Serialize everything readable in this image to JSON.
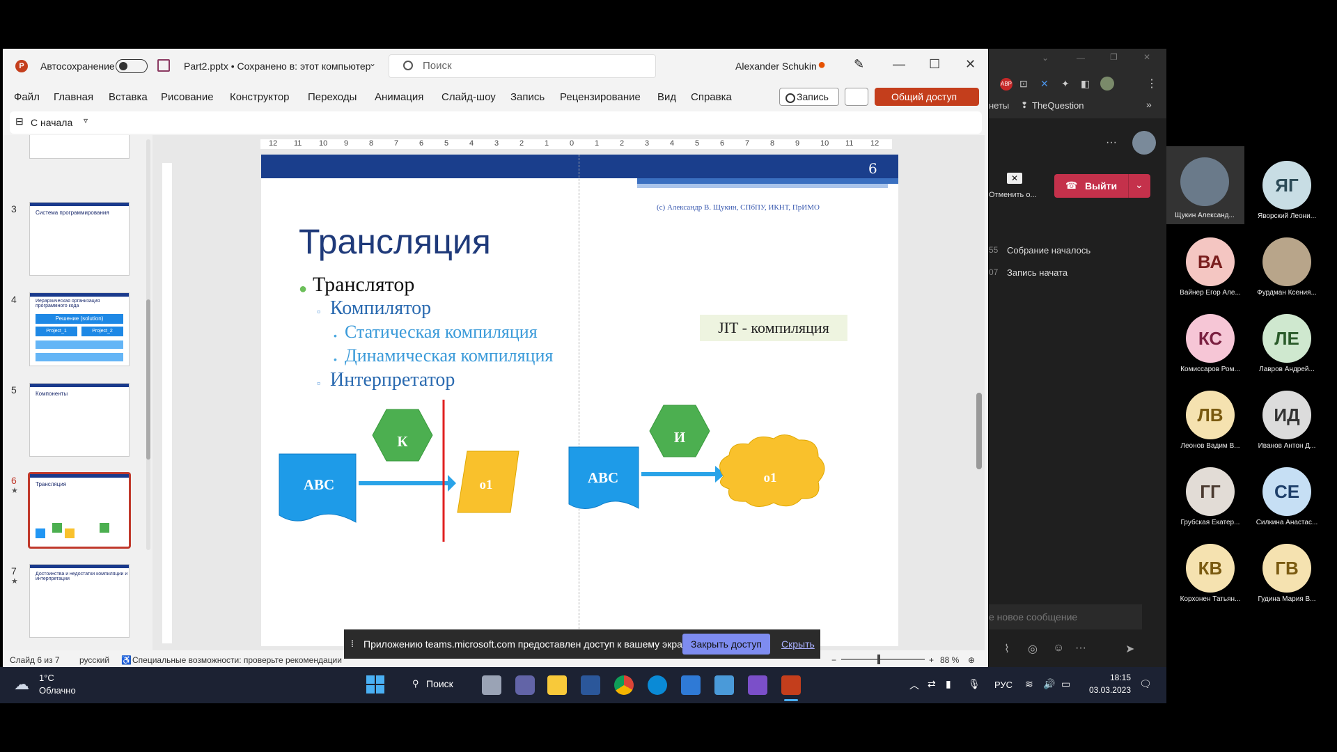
{
  "ppt": {
    "autosave_label": "Автосохранение",
    "file_title": "Part2.pptx • Сохранено в: этот компьютер",
    "search_placeholder": "Поиск",
    "user_name": "Alexander Schukin",
    "menu": [
      "Файл",
      "Главная",
      "Вставка",
      "Рисование",
      "Конструктор",
      "Переходы",
      "Анимация",
      "Слайд-шоу",
      "Запись",
      "Рецензирование",
      "Вид",
      "Справка"
    ],
    "record_label": "Запись",
    "share_label": "Общий доступ",
    "from_start_label": "С начала"
  },
  "thumbnails": [
    {
      "num": "3",
      "title": "Система программирования"
    },
    {
      "num": "4",
      "title": "Иерархическая организация программного кода",
      "box1": "Решение (solution)",
      "box2": "Project_1",
      "box3": "Project_2"
    },
    {
      "num": "5",
      "title": "Компоненты"
    },
    {
      "num": "6",
      "title": "Трансляция",
      "selected": true
    },
    {
      "num": "7",
      "title": "Достоинства и недостатки компиляции и интерпретации"
    }
  ],
  "slide": {
    "number": "6",
    "copyright": "(с) Александр В. Щукин, СПбПУ, ИКНТ, ПрИМО",
    "title": "Трансляция",
    "bullet1": "Транслятор",
    "bullet2a": "Компилятор",
    "bullet3a": "Статическая компиляция",
    "bullet3b": "Динамическая компиляция",
    "bullet2b": "Интерпретатор",
    "jit": "JIT - компиляция",
    "shapes": {
      "abc1": "ABC",
      "k": "К",
      "o1a": "o1",
      "abc2": "ABC",
      "i": "И",
      "o1b": "o1"
    }
  },
  "ruler_ticks": [
    "12",
    "11",
    "10",
    "9",
    "8",
    "7",
    "6",
    "5",
    "4",
    "3",
    "2",
    "1",
    "0",
    "1",
    "2",
    "3",
    "4",
    "5",
    "6",
    "7",
    "8",
    "9",
    "10",
    "11",
    "12"
  ],
  "notice": {
    "text": "Приложению teams.microsoft.com предоставлен доступ к вашему экрану.",
    "close_button": "Закрыть доступ",
    "hide_link": "Скрыть"
  },
  "statusbar": {
    "slide_of": "Слайд 6 из 7",
    "language": "русский",
    "accessibility": "Специальные возможности: проверьте рекомендации",
    "zoom": "88 %"
  },
  "taskbar": {
    "temp": "1°C",
    "weather": "Облачно",
    "search": "Поиск",
    "lang": "РУС",
    "time": "18:15",
    "date": "03.03.2023"
  },
  "teams": {
    "bookmark": "TheQuestion",
    "bookmark_prev": "неты",
    "leave_label": "Выйти",
    "cancel_label": "Отменить о...",
    "events": [
      {
        "time": "55",
        "text": "Собрание началось"
      },
      {
        "time": "07",
        "text": "Запись начата"
      }
    ],
    "message_placeholder": "е новое сообщение"
  },
  "participants": [
    {
      "initials": "",
      "name": "Щукин Александ...",
      "bg": "#6a7a8a",
      "fg": "#ffffff",
      "photo": true
    },
    {
      "initials": "ЯГ",
      "name": "Яворский Леони...",
      "bg": "#c8dde4",
      "fg": "#2c4a56"
    },
    {
      "initials": "ВА",
      "name": "Вайнер Егор Але...",
      "bg": "#f4c6c2",
      "fg": "#7a1e1e"
    },
    {
      "initials": "",
      "name": "Фурдман Ксения...",
      "bg": "#b8a58a",
      "fg": "#ffffff",
      "photo": true
    },
    {
      "initials": "КС",
      "name": "Комиссаров Ром...",
      "bg": "#f6c6d6",
      "fg": "#7a2040"
    },
    {
      "initials": "ЛЕ",
      "name": "Лавров Андрей...",
      "bg": "#cfe8cf",
      "fg": "#2a5a2a"
    },
    {
      "initials": "ЛВ",
      "name": "Леонов Вадим В...",
      "bg": "#f5e2b0",
      "fg": "#7a5a10"
    },
    {
      "initials": "ИД",
      "name": "Иванов Антон Д...",
      "bg": "#dcdcdc",
      "fg": "#333333"
    },
    {
      "initials": "ГГ",
      "name": "Грубская Екатер...",
      "bg": "#e2dcd6",
      "fg": "#4a3a30"
    },
    {
      "initials": "СЕ",
      "name": "Силкина Анастас...",
      "bg": "#c6dff4",
      "fg": "#1e3f6a"
    },
    {
      "initials": "КВ",
      "name": "Корхонен Татьян...",
      "bg": "#f5e2b0",
      "fg": "#7a5a10"
    },
    {
      "initials": "ГВ",
      "name": "Гудина Мария В...",
      "bg": "#f5e2b0",
      "fg": "#7a5a10"
    }
  ]
}
